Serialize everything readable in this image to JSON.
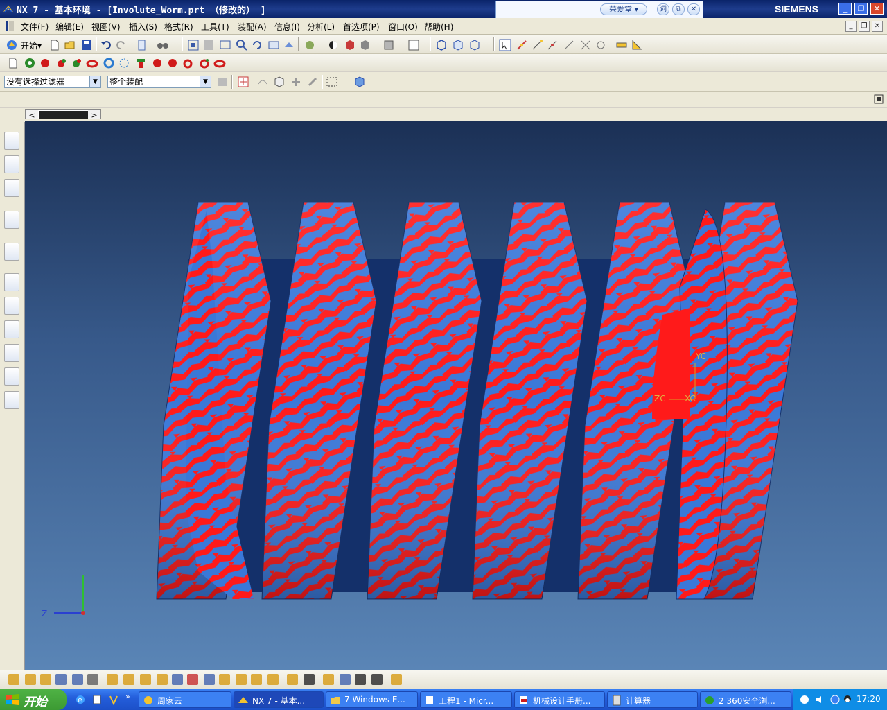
{
  "window": {
    "title": "NX 7 - 基本环境 - [Involute_Worm.prt （修改的） ]",
    "brand": "SIEMENS",
    "minimize": "_",
    "restore": "❐",
    "close": "✕"
  },
  "dict_popup": {
    "lookup_label": "荣爱堂 ▾",
    "word_btn": "词",
    "copy_btn": "⧉",
    "close_btn": "✕"
  },
  "menu": {
    "items": [
      "文件(F)",
      "编辑(E)",
      "视图(V)",
      "插入(S)",
      "格式(R)",
      "工具(T)",
      "装配(A)",
      "信息(I)",
      "分析(L)",
      "首选项(P)",
      "窗口(O)",
      "帮助(H)"
    ],
    "mdi_min": "_",
    "mdi_restore": "❐",
    "mdi_close": "✕"
  },
  "toolbar": {
    "start_label": "开始▾"
  },
  "selection_bar": {
    "filter_value": "没有选择过滤器",
    "scope_value": "整个装配"
  },
  "viewport": {
    "triad_wcs": {
      "yc": "YC",
      "zc": "ZC",
      "xc": "XC"
    },
    "triad_abs": {
      "z": "Z"
    },
    "model_colors": {
      "red": "#ff1a1a",
      "blue": "#3a78d8",
      "dark": "#14306a"
    }
  },
  "taskbar": {
    "start_label": "开始",
    "tasks": [
      {
        "label": "周家云"
      },
      {
        "label": "NX 7 - 基本..."
      },
      {
        "label": "7 Windows E..."
      },
      {
        "label": "工程1 - Micr..."
      },
      {
        "label": "机械设计手册..."
      },
      {
        "label": "计算器"
      },
      {
        "label": "2 360安全浏..."
      }
    ],
    "clock": "17:20"
  }
}
